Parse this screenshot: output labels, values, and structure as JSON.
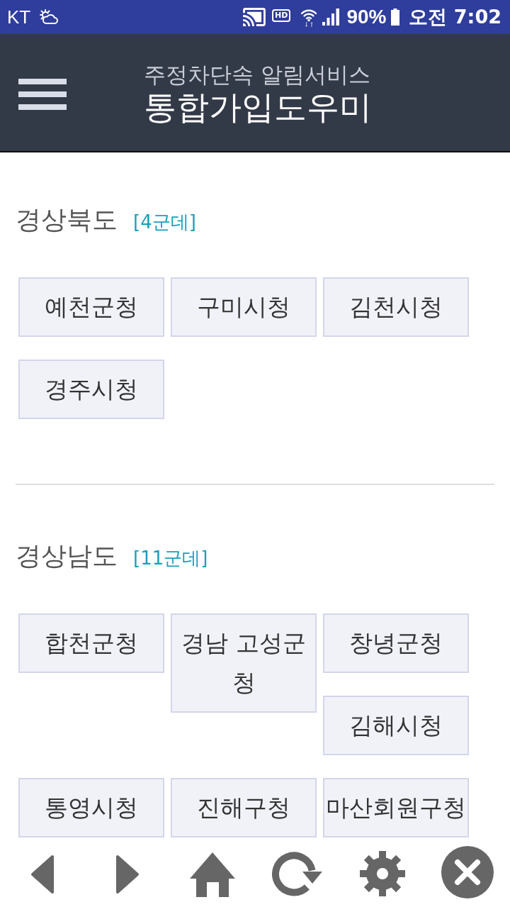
{
  "status_bar": {
    "carrier": "KT",
    "hd_label": "HD",
    "battery_percent": "90%",
    "time": "오전 7:02"
  },
  "header": {
    "subtitle": "주정차단속 알림서비스",
    "title": "통합가입도우미"
  },
  "regions": [
    {
      "name": "경상북도",
      "count": "[4군데]",
      "offices": [
        "예천군청",
        "구미시청",
        "김천시청",
        "경주시청"
      ]
    },
    {
      "name": "경상남도",
      "count": "[11군데]",
      "offices": [
        "합천군청",
        "경남 고성군청",
        "창녕군청",
        "김해시청",
        "통영시청",
        "진해구청",
        "마산회원구청"
      ]
    }
  ]
}
